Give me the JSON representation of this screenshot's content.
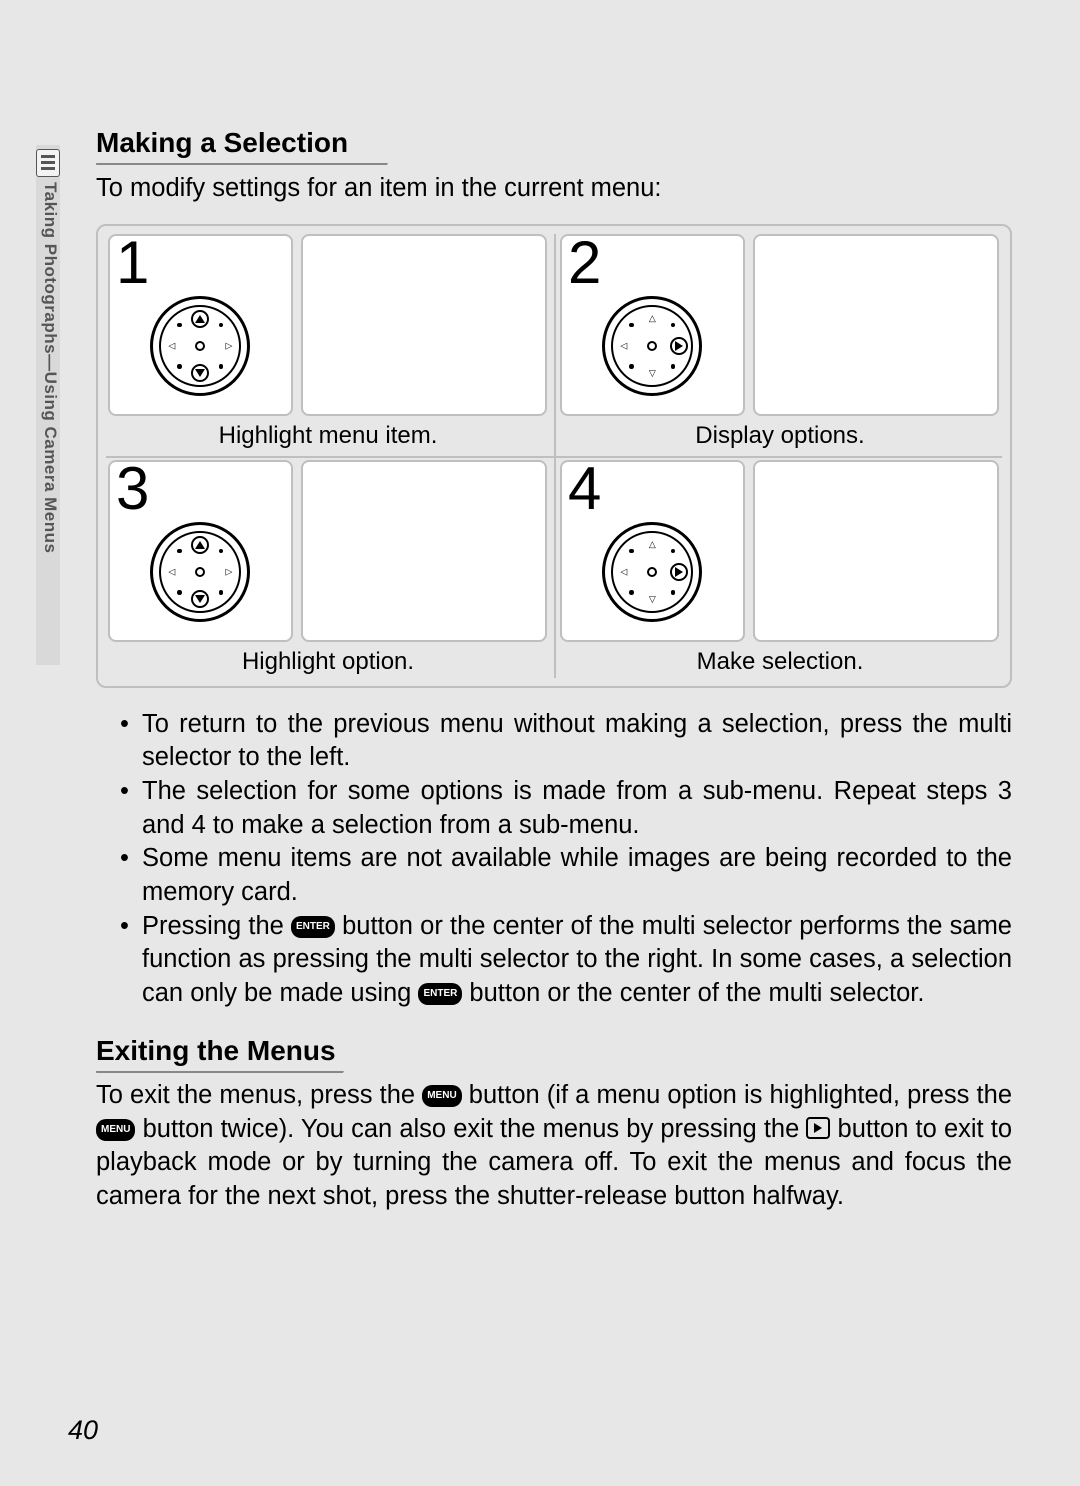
{
  "sidebar": {
    "label": "Taking Photographs—Using Camera Menus"
  },
  "heading1": "Making a Selection",
  "lead": "To modify settings for an item in the current menu:",
  "steps": [
    {
      "num": "1",
      "caption": "Highlight menu item."
    },
    {
      "num": "2",
      "caption": "Display options."
    },
    {
      "num": "3",
      "caption": "Highlight option."
    },
    {
      "num": "4",
      "caption": "Make selection."
    }
  ],
  "bullets": [
    "To return to the previous menu without making a selection, press the multi selector to the left.",
    "The selection for some options is made from a sub-menu.  Repeat steps 3 and 4 to make a selection from a sub-menu.",
    "Some menu items are not available while images are being recorded to the memory card."
  ],
  "bullet4": {
    "a": "Pressing the ",
    "icon1": "ENTER",
    "b": " button or the center of the multi selector performs the same function as pressing the multi selector to the right.  In some cases, a selection can only be made using ",
    "icon2": "ENTER",
    "c": " button or the center of the multi selector."
  },
  "heading2": "Exiting the Menus",
  "exit": {
    "a": "To exit the menus, press the ",
    "icon1": "MENU",
    "b": " button (if a menu option is highlighted, press the ",
    "icon2": "MENU",
    "c": " button twice).  You can also exit the menus by pressing the ",
    "d": " button to exit to playback mode or by turning the camera off.  To exit the menus and focus the camera for the next shot, press the shutter-release button halfway."
  },
  "pageNumber": "40"
}
